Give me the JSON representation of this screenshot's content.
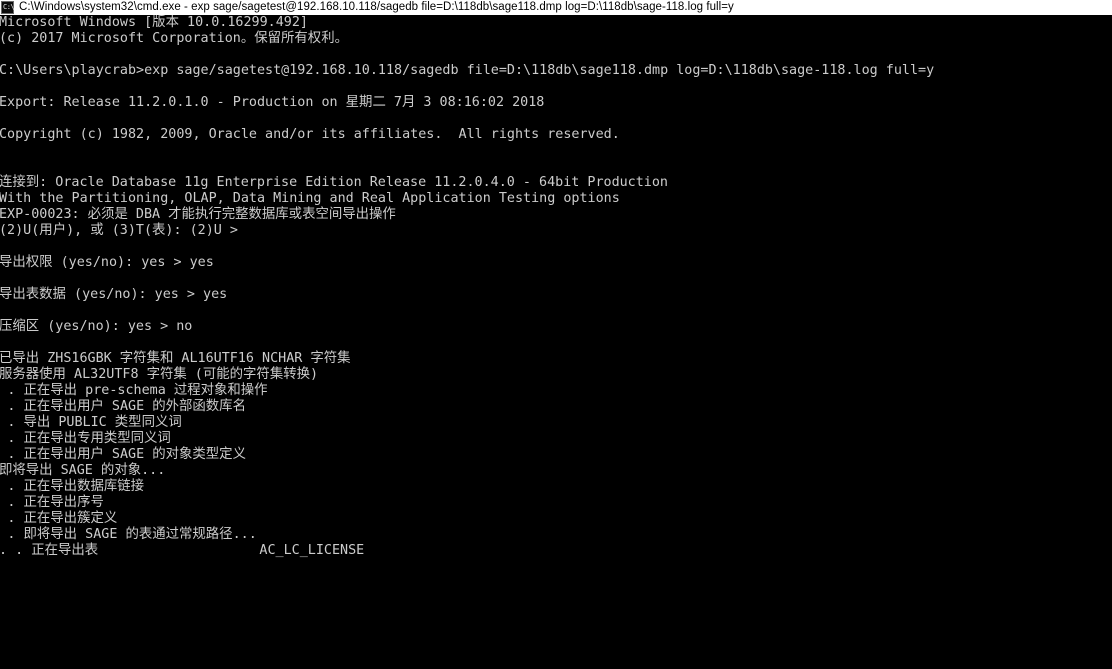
{
  "window": {
    "titlebar": {
      "icon": "cmd-console-icon",
      "icon_glyph": "C:\\",
      "title": "C:\\Windows\\system32\\cmd.exe -  exp  sage/sagetest@192.168.10.118/sagedb file=D:\\118db\\sage118.dmp log=D:\\118db\\sage-118.log full=y",
      "background_color": "#ffffff",
      "text_color": "#000000"
    },
    "console": {
      "background_color": "#000000",
      "text_color": "#cccccc",
      "char_width": 8.4,
      "line_height": 16,
      "lines": [
        {
          "row": 0,
          "col": 0,
          "text": "Microsoft Windows [版本 10.0.16299.492]"
        },
        {
          "row": 1,
          "col": 0,
          "text": "(c) 2017 Microsoft Corporation。保留所有权利。"
        },
        {
          "row": 3,
          "col": 0,
          "text": "C:\\Users\\playcrab>exp sage/sagetest@192.168.10.118/sagedb file=D:\\118db\\sage118.dmp log=D:\\118db\\sage-118.log full=y"
        },
        {
          "row": 5,
          "col": 0,
          "text": "Export: Release 11.2.0.1.0 - Production on 星期二 7月 3 08:16:02 2018"
        },
        {
          "row": 7,
          "col": 0,
          "text": "Copyright (c) 1982, 2009, Oracle and/or its affiliates.  All rights reserved."
        },
        {
          "row": 10,
          "col": 0,
          "text": "连接到: Oracle Database 11g Enterprise Edition Release 11.2.0.4.0 - 64bit Production"
        },
        {
          "row": 11,
          "col": 0,
          "text": "With the Partitioning, OLAP, Data Mining and Real Application Testing options"
        },
        {
          "row": 12,
          "col": 0,
          "text": "EXP-00023: 必须是 DBA 才能执行完整数据库或表空间导出操作"
        },
        {
          "row": 13,
          "col": 0,
          "text": "(2)U(用户), 或 (3)T(表): (2)U >"
        },
        {
          "row": 15,
          "col": 0,
          "text": "导出权限 (yes/no): yes > yes"
        },
        {
          "row": 17,
          "col": 0,
          "text": "导出表数据 (yes/no): yes > yes"
        },
        {
          "row": 19,
          "col": 0,
          "text": "压缩区 (yes/no): yes > no"
        },
        {
          "row": 21,
          "col": 0,
          "text": "已导出 ZHS16GBK 字符集和 AL16UTF16 NCHAR 字符集"
        },
        {
          "row": 22,
          "col": 0,
          "text": "服务器使用 AL32UTF8 字符集 (可能的字符集转换)"
        },
        {
          "row": 23,
          "col": 1,
          "text": ". 正在导出 pre-schema 过程对象和操作"
        },
        {
          "row": 24,
          "col": 1,
          "text": ". 正在导出用户 SAGE 的外部函数库名"
        },
        {
          "row": 25,
          "col": 1,
          "text": ". 导出 PUBLIC 类型同义词"
        },
        {
          "row": 26,
          "col": 1,
          "text": ". 正在导出专用类型同义词"
        },
        {
          "row": 27,
          "col": 1,
          "text": ". 正在导出用户 SAGE 的对象类型定义"
        },
        {
          "row": 28,
          "col": 0,
          "text": "即将导出 SAGE 的对象..."
        },
        {
          "row": 29,
          "col": 1,
          "text": ". 正在导出数据库链接"
        },
        {
          "row": 30,
          "col": 1,
          "text": ". 正在导出序号"
        },
        {
          "row": 31,
          "col": 1,
          "text": ". 正在导出簇定义"
        },
        {
          "row": 32,
          "col": 1,
          "text": ". 即将导出 SAGE 的表通过常规路径..."
        },
        {
          "row": 33,
          "col": 0,
          "text": ". . 正在导出表"
        },
        {
          "row": 33,
          "col": 31,
          "text": "AC_LC_LICENSE"
        }
      ]
    }
  }
}
